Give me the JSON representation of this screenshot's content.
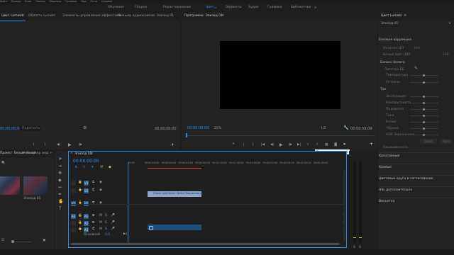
{
  "topmenu": [
    "Файл",
    "Правка",
    "Клип",
    "Эпизод",
    "Маркеры",
    "Графика",
    "Вид",
    "Окно",
    "Справка"
  ],
  "workspaces": [
    {
      "label": "Обучение",
      "active": false
    },
    {
      "label": "Сборка",
      "active": false
    },
    {
      "label": "Редактирование",
      "active": false
    },
    {
      "label": "Цвет",
      "active": true
    },
    {
      "label": "Эффекты",
      "active": false
    },
    {
      "label": "Аудио",
      "active": false
    },
    {
      "label": "Графика",
      "active": false
    },
    {
      "label": "Библиотеки",
      "active": false
    }
  ],
  "source_tabs": [
    "Цвет Lumetri",
    "Область Lumetri",
    "Элементы управления эффектами",
    "Микшер аудиоклипов: Эпизод 01"
  ],
  "source": {
    "timecode_left": "00;00;00;00",
    "fit": "Подогнать",
    "timecode_right": "00;00;00;00"
  },
  "program": {
    "tab": "Программа: Эпизод 01",
    "timecode": "00:00:00:00",
    "zoom": "25%",
    "fraction": "1/2",
    "duration": "00:00:59:09",
    "tooltip": "Переключить прокси"
  },
  "project": {
    "tab": "Проект: Безымянный",
    "media_tab": "Браузер мед",
    "item1": "",
    "item2": "Эпизод 01"
  },
  "timeline": {
    "tab": "Эпизод 01",
    "timecode": "00:00:00:00",
    "ruler": [
      "00:00",
      "00:00:15:00",
      "00:00:30:00",
      "00:00:45:00",
      "00:01:00:00",
      "00:01:15:00",
      "00:01:30:00",
      "00:01:45:00",
      "00:02:00:00",
      "00:02:15:00",
      "00:02:30:00",
      "00:02:45:00"
    ],
    "clip_label": "Очень light Warm Sketch Водовозов (V)",
    "tracks": [
      {
        "id": "V3",
        "lock": "",
        "toggle": "V3"
      },
      {
        "id": "V2",
        "lock": "",
        "toggle": "V2"
      },
      {
        "id": "V1",
        "lock": "V1",
        "toggle": "V1"
      },
      {
        "id": "A1",
        "lock": "A1",
        "toggle": "A1"
      },
      {
        "id": "A2",
        "lock": "",
        "toggle": "A2"
      },
      {
        "id": "A3",
        "lock": "",
        "toggle": "A3"
      }
    ],
    "master": "Основной",
    "master_value": "0,0"
  },
  "lumetri": {
    "title": "Цвет Lumetri",
    "clip": "Эпизод 01",
    "basic": "Базовая коррекция",
    "input_lut_label": "Входная LUT",
    "input_lut_value": "Нет",
    "hdr_label": "Белый свет HDR",
    "hdr_value": "100",
    "wb_title": "Баланс белого",
    "wb_picker": "Пипетка ББ",
    "wb_rows": [
      "Температура",
      "Оттенок"
    ],
    "tone_title": "Тон",
    "tone_rows": [
      "Экспозиция",
      "Контрастность",
      "Подсветка",
      "Тени",
      "Белые",
      "Чёрные",
      "HDR Зеркальные"
    ],
    "reset_btn": "Сброс",
    "auto_btn": "Авто",
    "saturation": "Насыщенность",
    "sections": [
      "Креативный",
      "Кривые",
      "Цветовые круги и согласование",
      "HSL дополнительно",
      "Виньетка"
    ]
  },
  "colors": {
    "accent": "#2d8ceb",
    "clip_v": "#8ea4c8",
    "clip_a": "#1f4d7a"
  }
}
